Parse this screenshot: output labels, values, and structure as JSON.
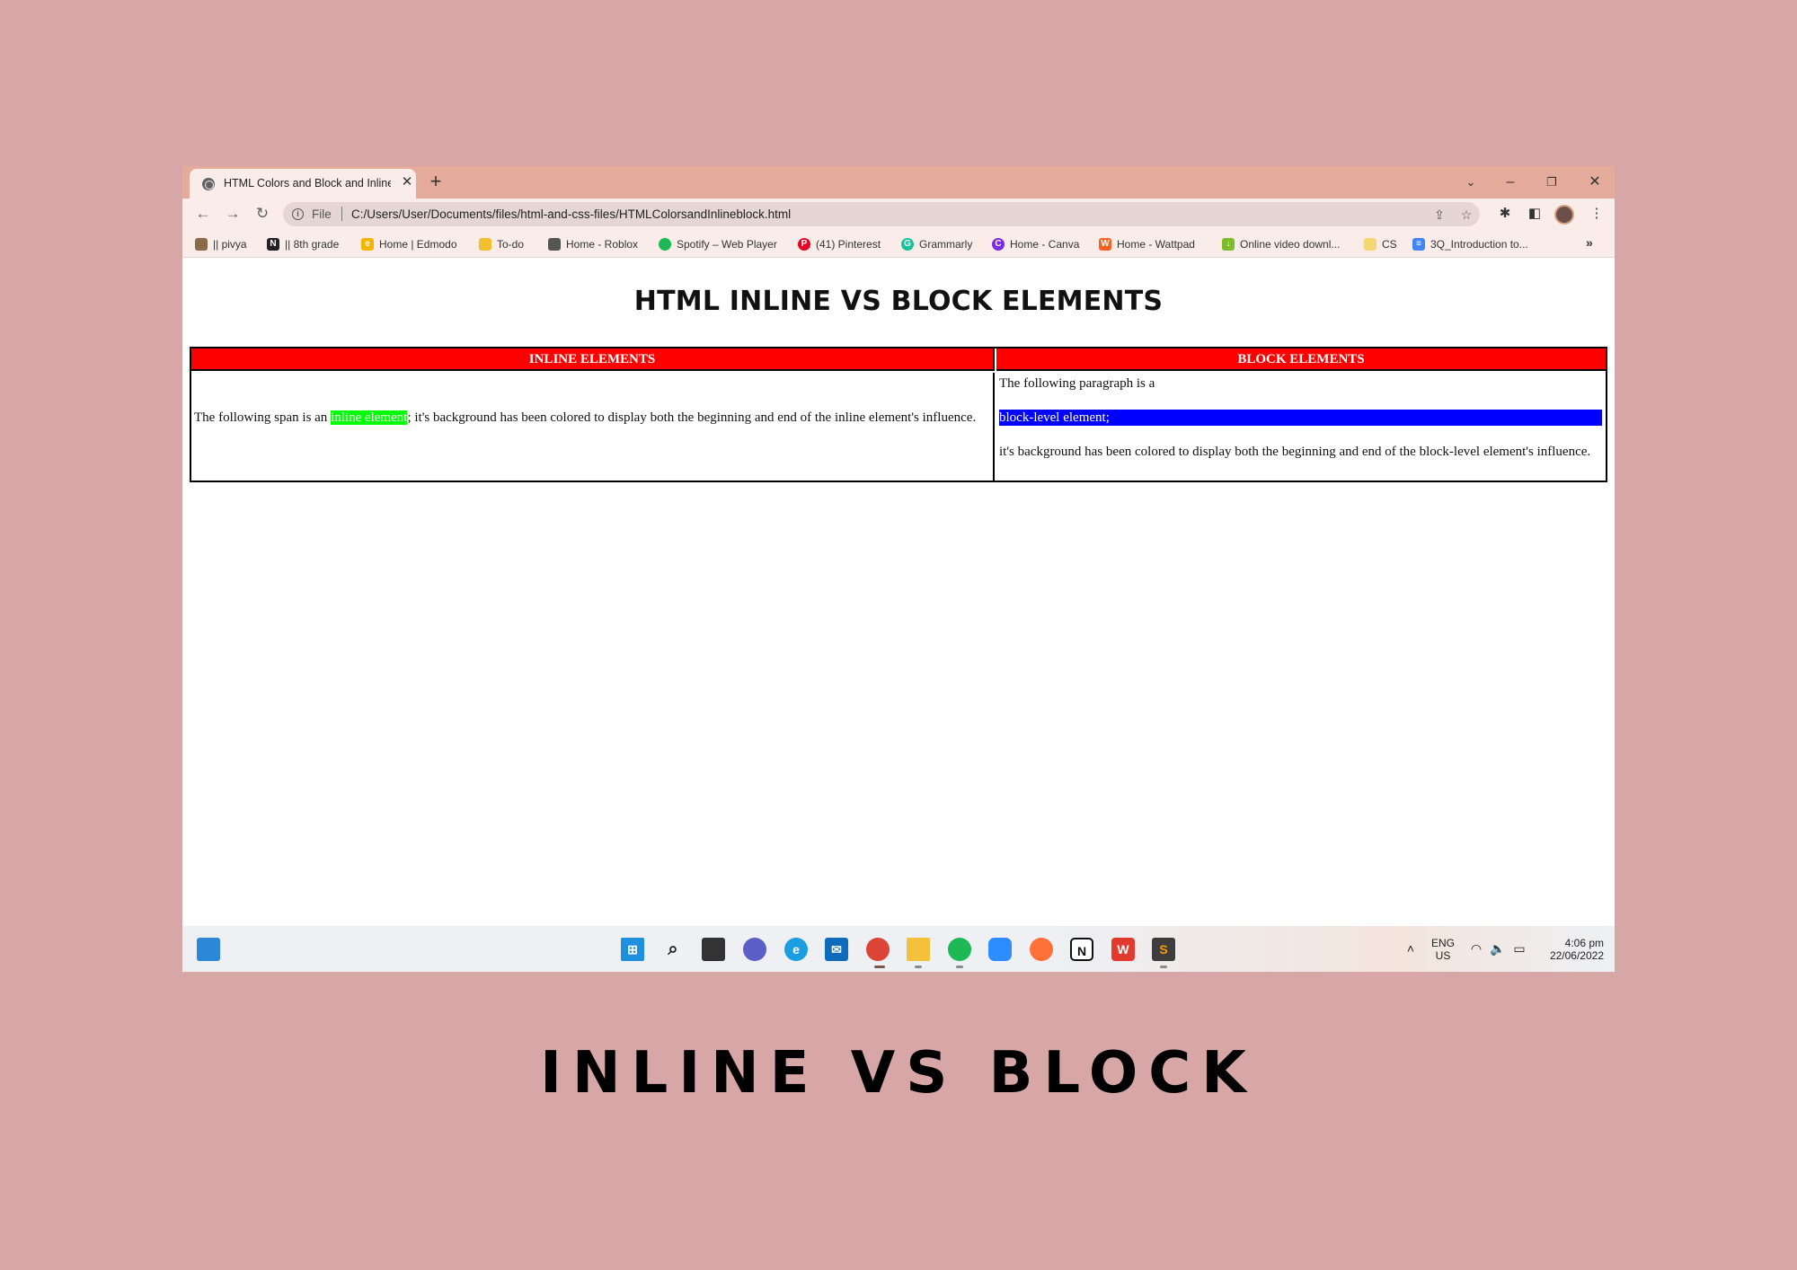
{
  "browser": {
    "tab_title": "HTML Colors and Block and Inline",
    "new_tab": "+",
    "url_scheme": "File",
    "url": "C:/Users/User/Documents/files/html-and-css-files/HTMLColorsandInlineblock.html",
    "bookmarks": [
      {
        "label": "|| pivya",
        "icon": "photo-icon",
        "color": "#8b6b4a"
      },
      {
        "label": "|| 8th grade",
        "icon": "notion-icon",
        "color": "#222222"
      },
      {
        "label": "Home | Edmodo",
        "icon": "edmodo-icon",
        "color": "#f5b400"
      },
      {
        "label": "To-do",
        "icon": "todo-icon",
        "color": "#f0c030"
      },
      {
        "label": "Home - Roblox",
        "icon": "roblox-icon",
        "color": "#555555"
      },
      {
        "label": "Spotify – Web Player",
        "icon": "spotify-icon",
        "color": "#1db954"
      },
      {
        "label": "(41) Pinterest",
        "icon": "pinterest-icon",
        "color": "#e60023"
      },
      {
        "label": "Grammarly",
        "icon": "grammarly-icon",
        "color": "#15c39a"
      },
      {
        "label": "Home - Canva",
        "icon": "canva-icon",
        "color": "#7d2ae8"
      },
      {
        "label": "Home - Wattpad",
        "icon": "wattpad-icon",
        "color": "#ff6122"
      },
      {
        "label": "Online video downl...",
        "icon": "download-icon",
        "color": "#7cbb2a"
      },
      {
        "label": "CS",
        "icon": "folder-icon",
        "color": "#f7d774"
      },
      {
        "label": "3Q_Introduction to...",
        "icon": "docs-icon",
        "color": "#4285f4"
      }
    ],
    "bookmarks_more": "»"
  },
  "page": {
    "title": "HTML INLINE VS BLOCK ELEMENTS",
    "table": {
      "header_inline": "INLINE ELEMENTS",
      "header_block": "BLOCK ELEMENTS",
      "inline_before": "The following span is an ",
      "inline_span": "inline element",
      "inline_after": "; it's background has been colored to display both the beginning and end of the inline element's influence.",
      "block_p1": "The following paragraph is a",
      "block_p2": "block-level element;",
      "block_p3": "it's background has been colored to display both the beginning and end of the block-level element's influence."
    }
  },
  "taskbar": {
    "lang_top": "ENG",
    "lang_bottom": "US",
    "time": "4:06 pm",
    "date": "22/06/2022"
  },
  "caption": "INLINE VS BLOCK",
  "colors": {
    "header_red": "#ff0000",
    "inline_green": "#00ff00",
    "block_blue": "#0000ff",
    "backdrop": "#d7a7a8"
  }
}
